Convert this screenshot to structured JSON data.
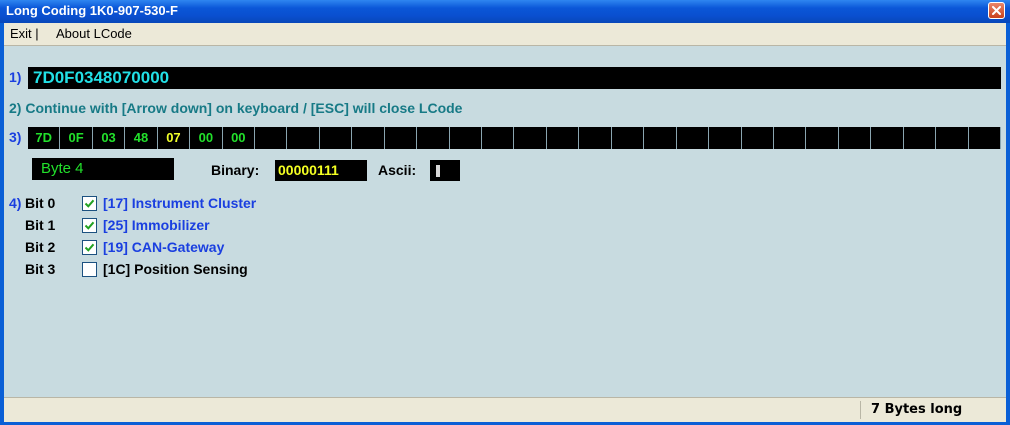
{
  "window": {
    "title": "Long Coding  1K0-907-530-F"
  },
  "menu": {
    "exit": "Exit |",
    "about": "About LCode"
  },
  "step1": {
    "label": "1)",
    "coding": "7D0F0348070000"
  },
  "step2": {
    "text": "2) Continue with [Arrow down] on keyboard / [ESC] will close LCode"
  },
  "step3": {
    "label": "3)",
    "bytes": [
      "7D",
      "0F",
      "03",
      "48",
      "07",
      "00",
      "00"
    ],
    "selected_index": 4,
    "total_cells": 30,
    "byte_label": "Byte 4",
    "binary_label": "Binary:",
    "binary_value": "00000111",
    "ascii_label": "Ascii:"
  },
  "step4": {
    "label": "4)",
    "bits": [
      {
        "bit": "Bit 0",
        "checked": true,
        "text": "[17] Instrument Cluster"
      },
      {
        "bit": "Bit 1",
        "checked": true,
        "text": "[25] Immobilizer"
      },
      {
        "bit": "Bit 2",
        "checked": true,
        "text": "[19] CAN-Gateway"
      },
      {
        "bit": "Bit 3",
        "checked": false,
        "text": "[1C] Position Sensing"
      }
    ]
  },
  "status": {
    "length": "7 Bytes long"
  },
  "colors": {
    "title_blue": "#0a4fcf",
    "field_black": "#000000",
    "byte_green": "#22e02b",
    "byte_selected_yellow": "#f0ff2a",
    "coding_cyan": "#22e0e6",
    "link_blue": "#1a3fe0",
    "hint_teal": "#177a86",
    "client_bg": "#c8dbe0"
  },
  "icons": {
    "close": "close-x-icon",
    "check": "checkmark-icon"
  }
}
